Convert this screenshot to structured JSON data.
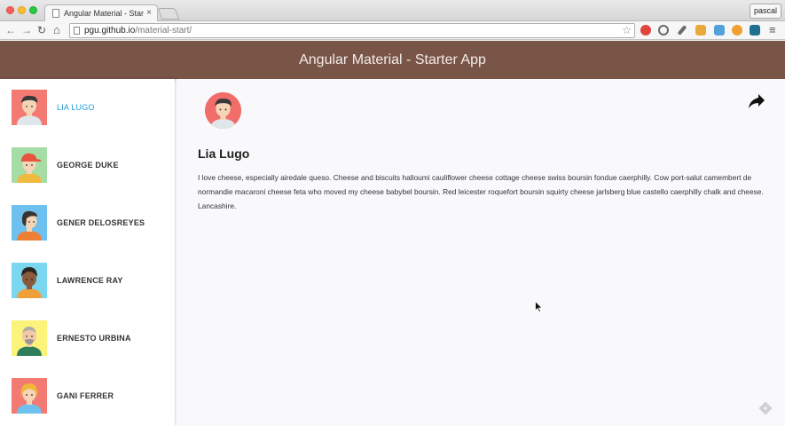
{
  "browser": {
    "tab_title": "Angular Material - Starter /",
    "tab_close": "×",
    "profile": "pascal",
    "url_host": "pgu.github.io",
    "url_path": "/material-start/",
    "star": "☆",
    "back": "←",
    "forward": "→",
    "reload": "↻",
    "home": "⌂",
    "menu": "≡",
    "extension_colors": [
      "#e1453c",
      "#6a6a6a",
      "#6a6a6a",
      "#e8a93a",
      "#54a0d8",
      "#f0a030",
      "#1f6f8f"
    ]
  },
  "app": {
    "title": "Angular Material - Starter App",
    "header_color": "#795548",
    "accent": "#1e9bd6"
  },
  "users": [
    {
      "name": "LIA LUGO",
      "selected": true,
      "bg": "#f27a72"
    },
    {
      "name": "GEORGE DUKE",
      "selected": false,
      "bg": "#a5dda5"
    },
    {
      "name": "GENER DELOSREYES",
      "selected": false,
      "bg": "#6ec1ee"
    },
    {
      "name": "LAWRENCE RAY",
      "selected": false,
      "bg": "#7ad7ef"
    },
    {
      "name": "ERNESTO URBINA",
      "selected": false,
      "bg": "#fbf37a"
    },
    {
      "name": "GANI FERRER",
      "selected": false,
      "bg": "#f27a72"
    }
  ],
  "detail": {
    "name": "Lia Lugo",
    "bio": "I love cheese, especially airedale queso. Cheese and biscuits halloumi cauliflower cheese cottage cheese swiss boursin fondue caerphilly. Cow port-salut camembert de normandie macaroni cheese feta who moved my cheese babybel boursin. Red leicester roquefort boursin squirty cheese jarlsberg blue castello caerphilly chalk and cheese. Lancashire."
  }
}
